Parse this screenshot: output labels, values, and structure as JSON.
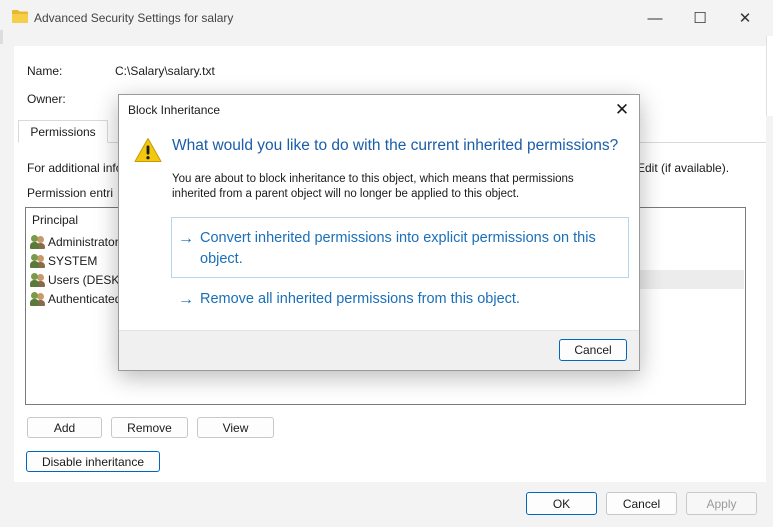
{
  "window": {
    "title": "Advanced Security Settings for salary",
    "icon": "folder-icon",
    "minimize_glyph": "—",
    "maximize_glyph": "☐",
    "close_glyph": "✕"
  },
  "details": {
    "name_label": "Name:",
    "name_value": "C:\\Salary\\salary.txt",
    "owner_label": "Owner:"
  },
  "tabs": [
    {
      "label": "Permissions",
      "active": true
    }
  ],
  "info_text_start": "For additional info",
  "info_text_end": "Edit (if available).",
  "entries_label": "Permission entri",
  "table": {
    "column_principal": "Principal",
    "rows": [
      {
        "principal": "Administrator"
      },
      {
        "principal": "SYSTEM"
      },
      {
        "principal": "Users (DESKTO"
      },
      {
        "principal": "Authenticated"
      }
    ]
  },
  "buttons": {
    "add": "Add",
    "remove": "Remove",
    "view": "View",
    "disable_inheritance": "Disable inheritance",
    "ok": "OK",
    "cancel": "Cancel",
    "apply": "Apply"
  },
  "dialog": {
    "title": "Block Inheritance",
    "close_glyph": "✕",
    "icon": "warning-icon",
    "heading": "What would you like to do with the current inherited permissions?",
    "body": "You are about to block inheritance to this object, which means that permissions inherited from a parent object will no longer be applied to this object.",
    "arrow_glyph": "→",
    "option_convert": "Convert inherited permissions into explicit permissions on this object.",
    "option_remove": "Remove all inherited permissions from this object.",
    "cancel": "Cancel"
  },
  "colors": {
    "accent": "#1a6fb9",
    "heading": "#1a5da8",
    "warning": "#f2c811"
  }
}
